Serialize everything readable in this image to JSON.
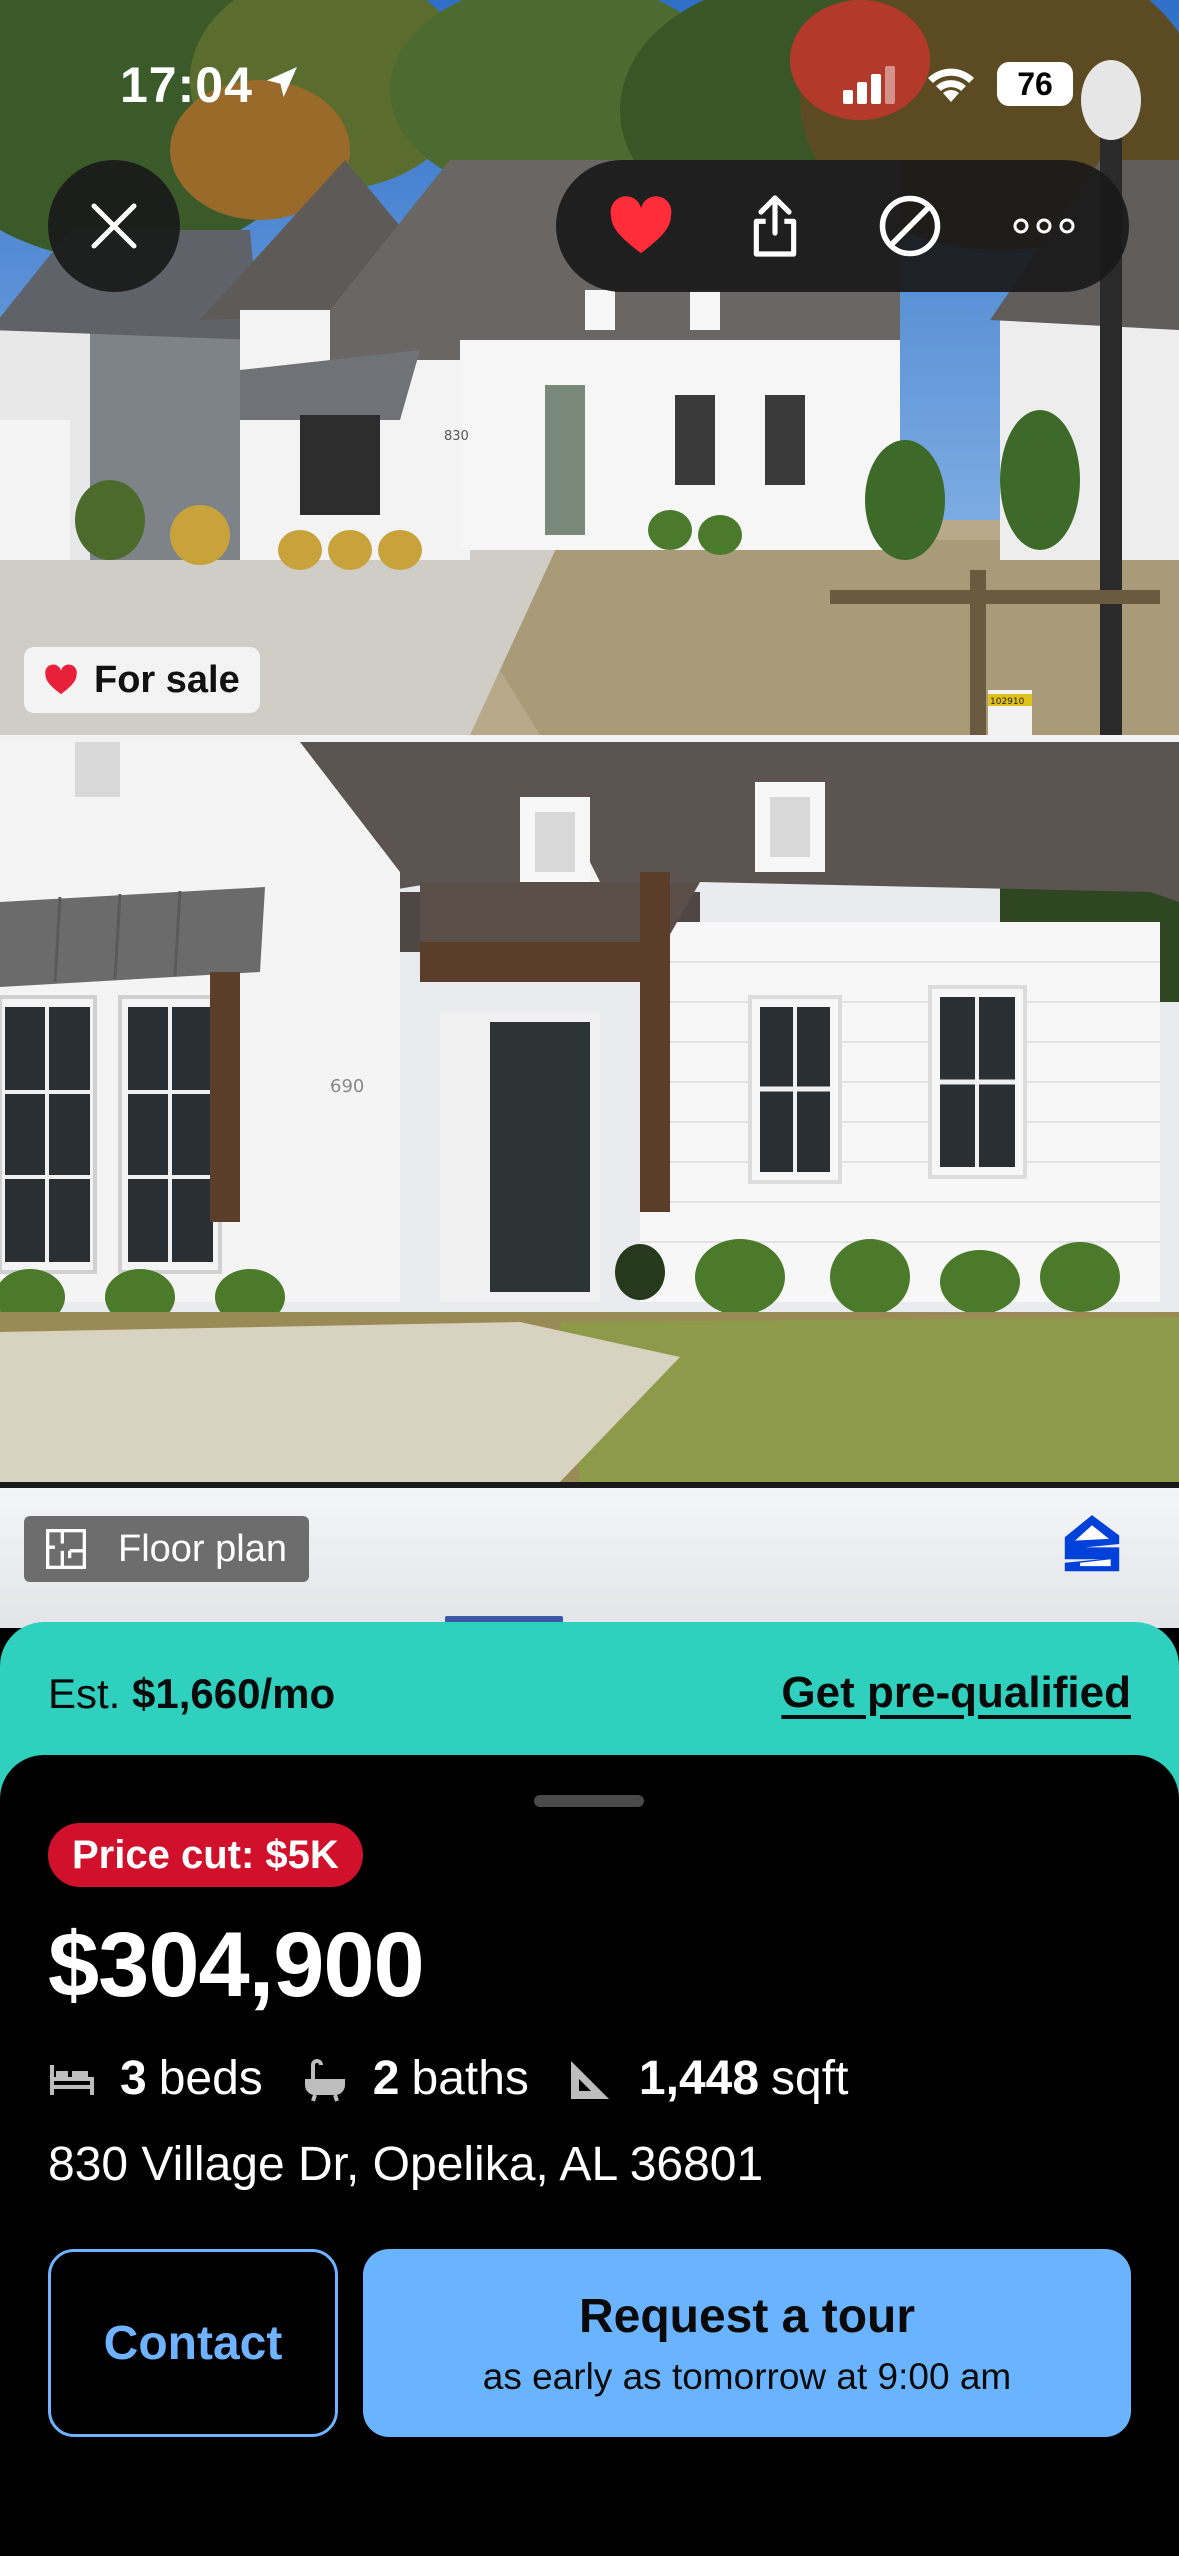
{
  "status_bar": {
    "time": "17:04",
    "battery": "76"
  },
  "photo_badge": {
    "label": "For sale"
  },
  "photo_labels": {
    "house_number_1": "830",
    "house_number_2": "690",
    "sign_tag": "102910"
  },
  "floor_plan": {
    "label": "Floor plan"
  },
  "prequal": {
    "est_prefix": "Est.",
    "est_amount": "$1,660/mo",
    "link": "Get pre-qualified"
  },
  "listing": {
    "price_cut": "Price cut: $5K",
    "price": "$304,900",
    "beds_num": "3",
    "beds_unit": "beds",
    "baths_num": "2",
    "baths_unit": "baths",
    "sqft_num": "1,448",
    "sqft_unit": "sqft",
    "address": "830 Village Dr, Opelika, AL 36801"
  },
  "actions": {
    "contact": "Contact",
    "tour_title": "Request a tour",
    "tour_subtitle": "as early as tomorrow at 9:00 am"
  },
  "icons": [
    "close-icon",
    "heart-icon",
    "share-icon",
    "hide-icon",
    "more-icon",
    "bed-icon",
    "bath-icon",
    "sqft-icon",
    "floor-plan-icon",
    "zillow-logo"
  ],
  "colors": {
    "accent_teal": "#2fd0bd",
    "price_cut_red": "#d1112b",
    "tour_blue": "#6ab4ff",
    "contact_blue": "#6fb2ff",
    "favorite_red": "#ff2d3a"
  }
}
